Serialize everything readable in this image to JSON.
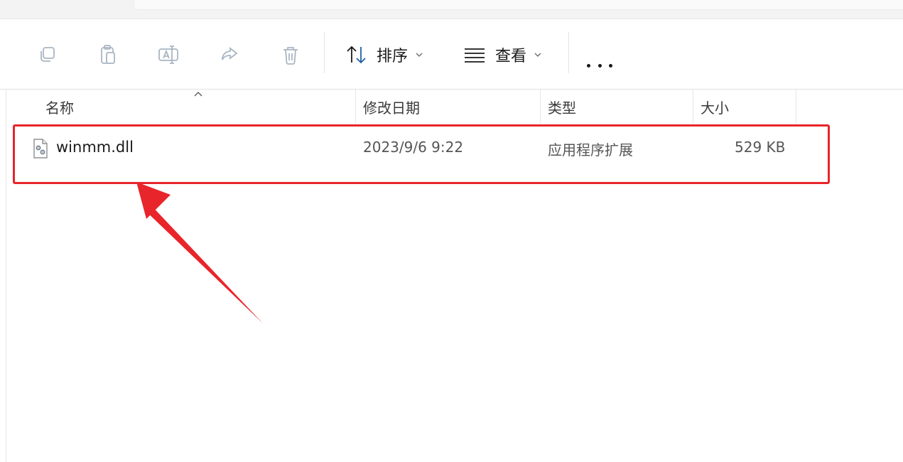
{
  "toolbar": {
    "icons": [
      "copy-icon",
      "paste-icon",
      "rename-icon",
      "share-icon",
      "delete-icon"
    ],
    "sort_label": "排序",
    "view_label": "查看",
    "more_label": "更多"
  },
  "columns": {
    "name": "名称",
    "modified": "修改日期",
    "type": "类型",
    "size": "大小"
  },
  "files": [
    {
      "name": "winmm.dll",
      "modified": "2023/9/6 9:22",
      "type": "应用程序扩展",
      "size": "529 KB",
      "icon": "dll-file-icon"
    }
  ],
  "colors": {
    "highlight": "#e8252a",
    "disabled_icon": "#9aa6b2",
    "sort_icon": "#1f5fa8"
  }
}
